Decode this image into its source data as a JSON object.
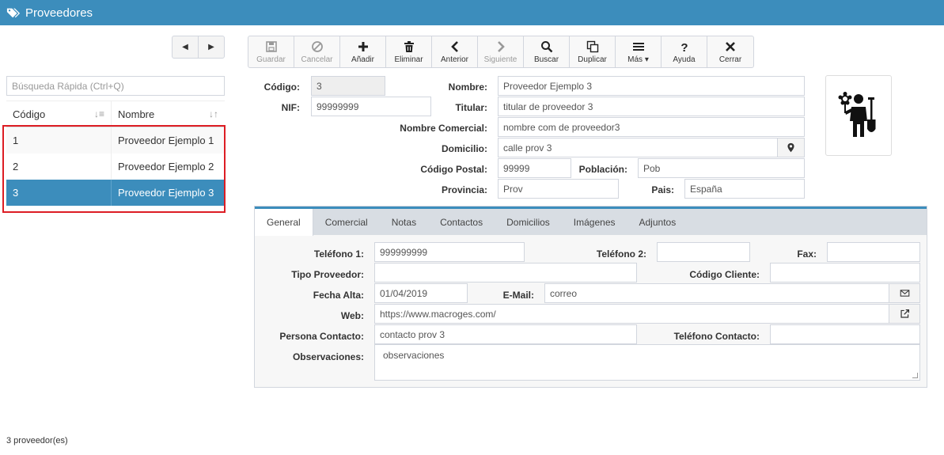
{
  "window": {
    "title": "Proveedores",
    "icon": "tags-icon"
  },
  "nav": {
    "prev_icon": "caret-left-icon",
    "next_icon": "caret-right-icon"
  },
  "left": {
    "search_placeholder": "Búsqueda Rápida (Ctrl+Q)",
    "columns": [
      "Código",
      "Nombre"
    ],
    "rows": [
      {
        "codigo": "1",
        "nombre": "Proveedor Ejemplo 1"
      },
      {
        "codigo": "2",
        "nombre": "Proveedor Ejemplo 2"
      },
      {
        "codigo": "3",
        "nombre": "Proveedor Ejemplo 3"
      }
    ],
    "selected_row": 2,
    "count_label": "3 proveedor(es)"
  },
  "toolbar": {
    "buttons": [
      {
        "label": "Guardar",
        "icon": "save-icon",
        "disabled": true
      },
      {
        "label": "Cancelar",
        "icon": "ban-icon",
        "disabled": true
      },
      {
        "label": "Añadir",
        "icon": "plus-icon",
        "disabled": false
      },
      {
        "label": "Eliminar",
        "icon": "trash-icon",
        "disabled": false
      },
      {
        "label": "Anterior",
        "icon": "chevron-left-icon",
        "disabled": false
      },
      {
        "label": "Siguiente",
        "icon": "chevron-right-icon",
        "disabled": true
      },
      {
        "label": "Buscar",
        "icon": "search-icon",
        "disabled": false
      },
      {
        "label": "Duplicar",
        "icon": "copy-icon",
        "disabled": false
      },
      {
        "label": "Más",
        "icon": "bars-icon",
        "disabled": false
      },
      {
        "label": "Ayuda",
        "icon": "question-icon",
        "disabled": false
      },
      {
        "label": "Cerrar",
        "icon": "close-icon",
        "disabled": false
      }
    ]
  },
  "form": {
    "codigo": {
      "label": "Código:",
      "value": "3"
    },
    "nombre": {
      "label": "Nombre:",
      "value": "Proveedor Ejemplo 3"
    },
    "nif": {
      "label": "NIF:",
      "value": "99999999"
    },
    "titular": {
      "label": "Titular:",
      "value": "titular de proveedor 3"
    },
    "nombre_comercial": {
      "label": "Nombre Comercial:",
      "value": "nombre com de proveedor3"
    },
    "domicilio": {
      "label": "Domicilio:",
      "value": "calle prov 3"
    },
    "codigo_postal": {
      "label": "Código Postal:",
      "value": "99999"
    },
    "poblacion": {
      "label": "Población:",
      "value": "Pob"
    },
    "provincia": {
      "label": "Provincia:",
      "value": "Prov"
    },
    "pais": {
      "label": "Pais:",
      "value": "España"
    }
  },
  "tabs": [
    "General",
    "Comercial",
    "Notas",
    "Contactos",
    "Domicilios",
    "Imágenes",
    "Adjuntos"
  ],
  "general": {
    "telefono1": {
      "label": "Teléfono 1:",
      "value": "999999999"
    },
    "telefono2": {
      "label": "Teléfono 2:",
      "value": ""
    },
    "fax": {
      "label": "Fax:",
      "value": ""
    },
    "tipo_proveedor": {
      "label": "Tipo Proveedor:",
      "value": ""
    },
    "codigo_cliente": {
      "label": "Código Cliente:",
      "value": ""
    },
    "fecha_alta": {
      "label": "Fecha Alta:",
      "value": "01/04/2019"
    },
    "email": {
      "label": "E-Mail:",
      "value": "correo"
    },
    "web": {
      "label": "Web:",
      "value": "https://www.macroges.com/"
    },
    "persona_contacto": {
      "label": "Persona Contacto:",
      "value": "contacto prov 3"
    },
    "telefono_contacto": {
      "label": "Teléfono Contacto:",
      "value": ""
    },
    "observaciones": {
      "label": "Observaciones:",
      "value": "observaciones"
    }
  },
  "colors": {
    "accent": "#3c8dbc",
    "highlight": "#dd1d24"
  }
}
